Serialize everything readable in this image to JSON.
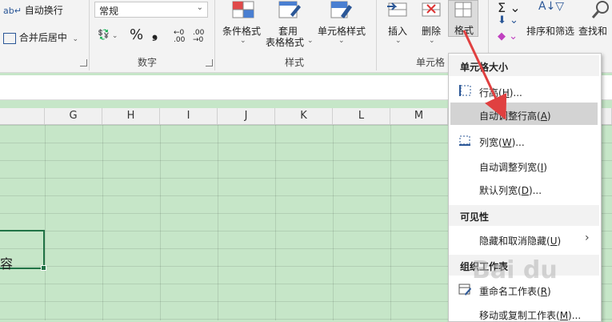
{
  "ribbon": {
    "wrap_text": "自动换行",
    "merge_center": "合并后居中",
    "number_format": "常规",
    "percent": "%",
    "comma": "❟",
    "group_number": "数字",
    "group_styles": "样式",
    "group_cells": "单元格",
    "conditional_format": "条件格式",
    "format_as_table": "套用\n表格格式",
    "format_as_table_line1": "套用",
    "format_as_table_line2": "表格格式",
    "cell_styles": "单元格样式",
    "insert": "插入",
    "delete": "删除",
    "format": "格式",
    "sort_filter": "排序和筛选",
    "find_select": "查找和"
  },
  "columns": [
    "G",
    "H",
    "I",
    "J",
    "K",
    "L",
    "M"
  ],
  "cell_text": "容",
  "menu": {
    "section1": "单元格大小",
    "row_height": "行高(H)...",
    "row_height_label": "行高(",
    "row_height_key": "H",
    "row_height_tail": ")...",
    "autofit_row": "自动调整行高(A)",
    "autofit_row_label": "自动调整行高(",
    "autofit_row_key": "A",
    "autofit_row_tail": ")",
    "col_width_label": "列宽(",
    "col_width_key": "W",
    "col_width_tail": ")...",
    "autofit_col_label": "自动调整列宽(",
    "autofit_col_key": "I",
    "autofit_col_tail": ")",
    "default_width_label": "默认列宽(",
    "default_width_key": "D",
    "default_width_tail": ")...",
    "section2": "可见性",
    "hide_label": "隐藏和取消隐藏(",
    "hide_key": "U",
    "hide_tail": ")",
    "section3": "组织工作表",
    "rename_label": "重命名工作表(",
    "rename_key": "R",
    "rename_tail": ")",
    "move_copy_label": "移动或复制工作表(",
    "move_copy_key": "M",
    "move_copy_tail": ")..."
  },
  "watermark": "Bai du",
  "colors": {
    "sheet_bg": "#c6e6c8",
    "accent": "#217346",
    "arrow": "#e04040"
  }
}
